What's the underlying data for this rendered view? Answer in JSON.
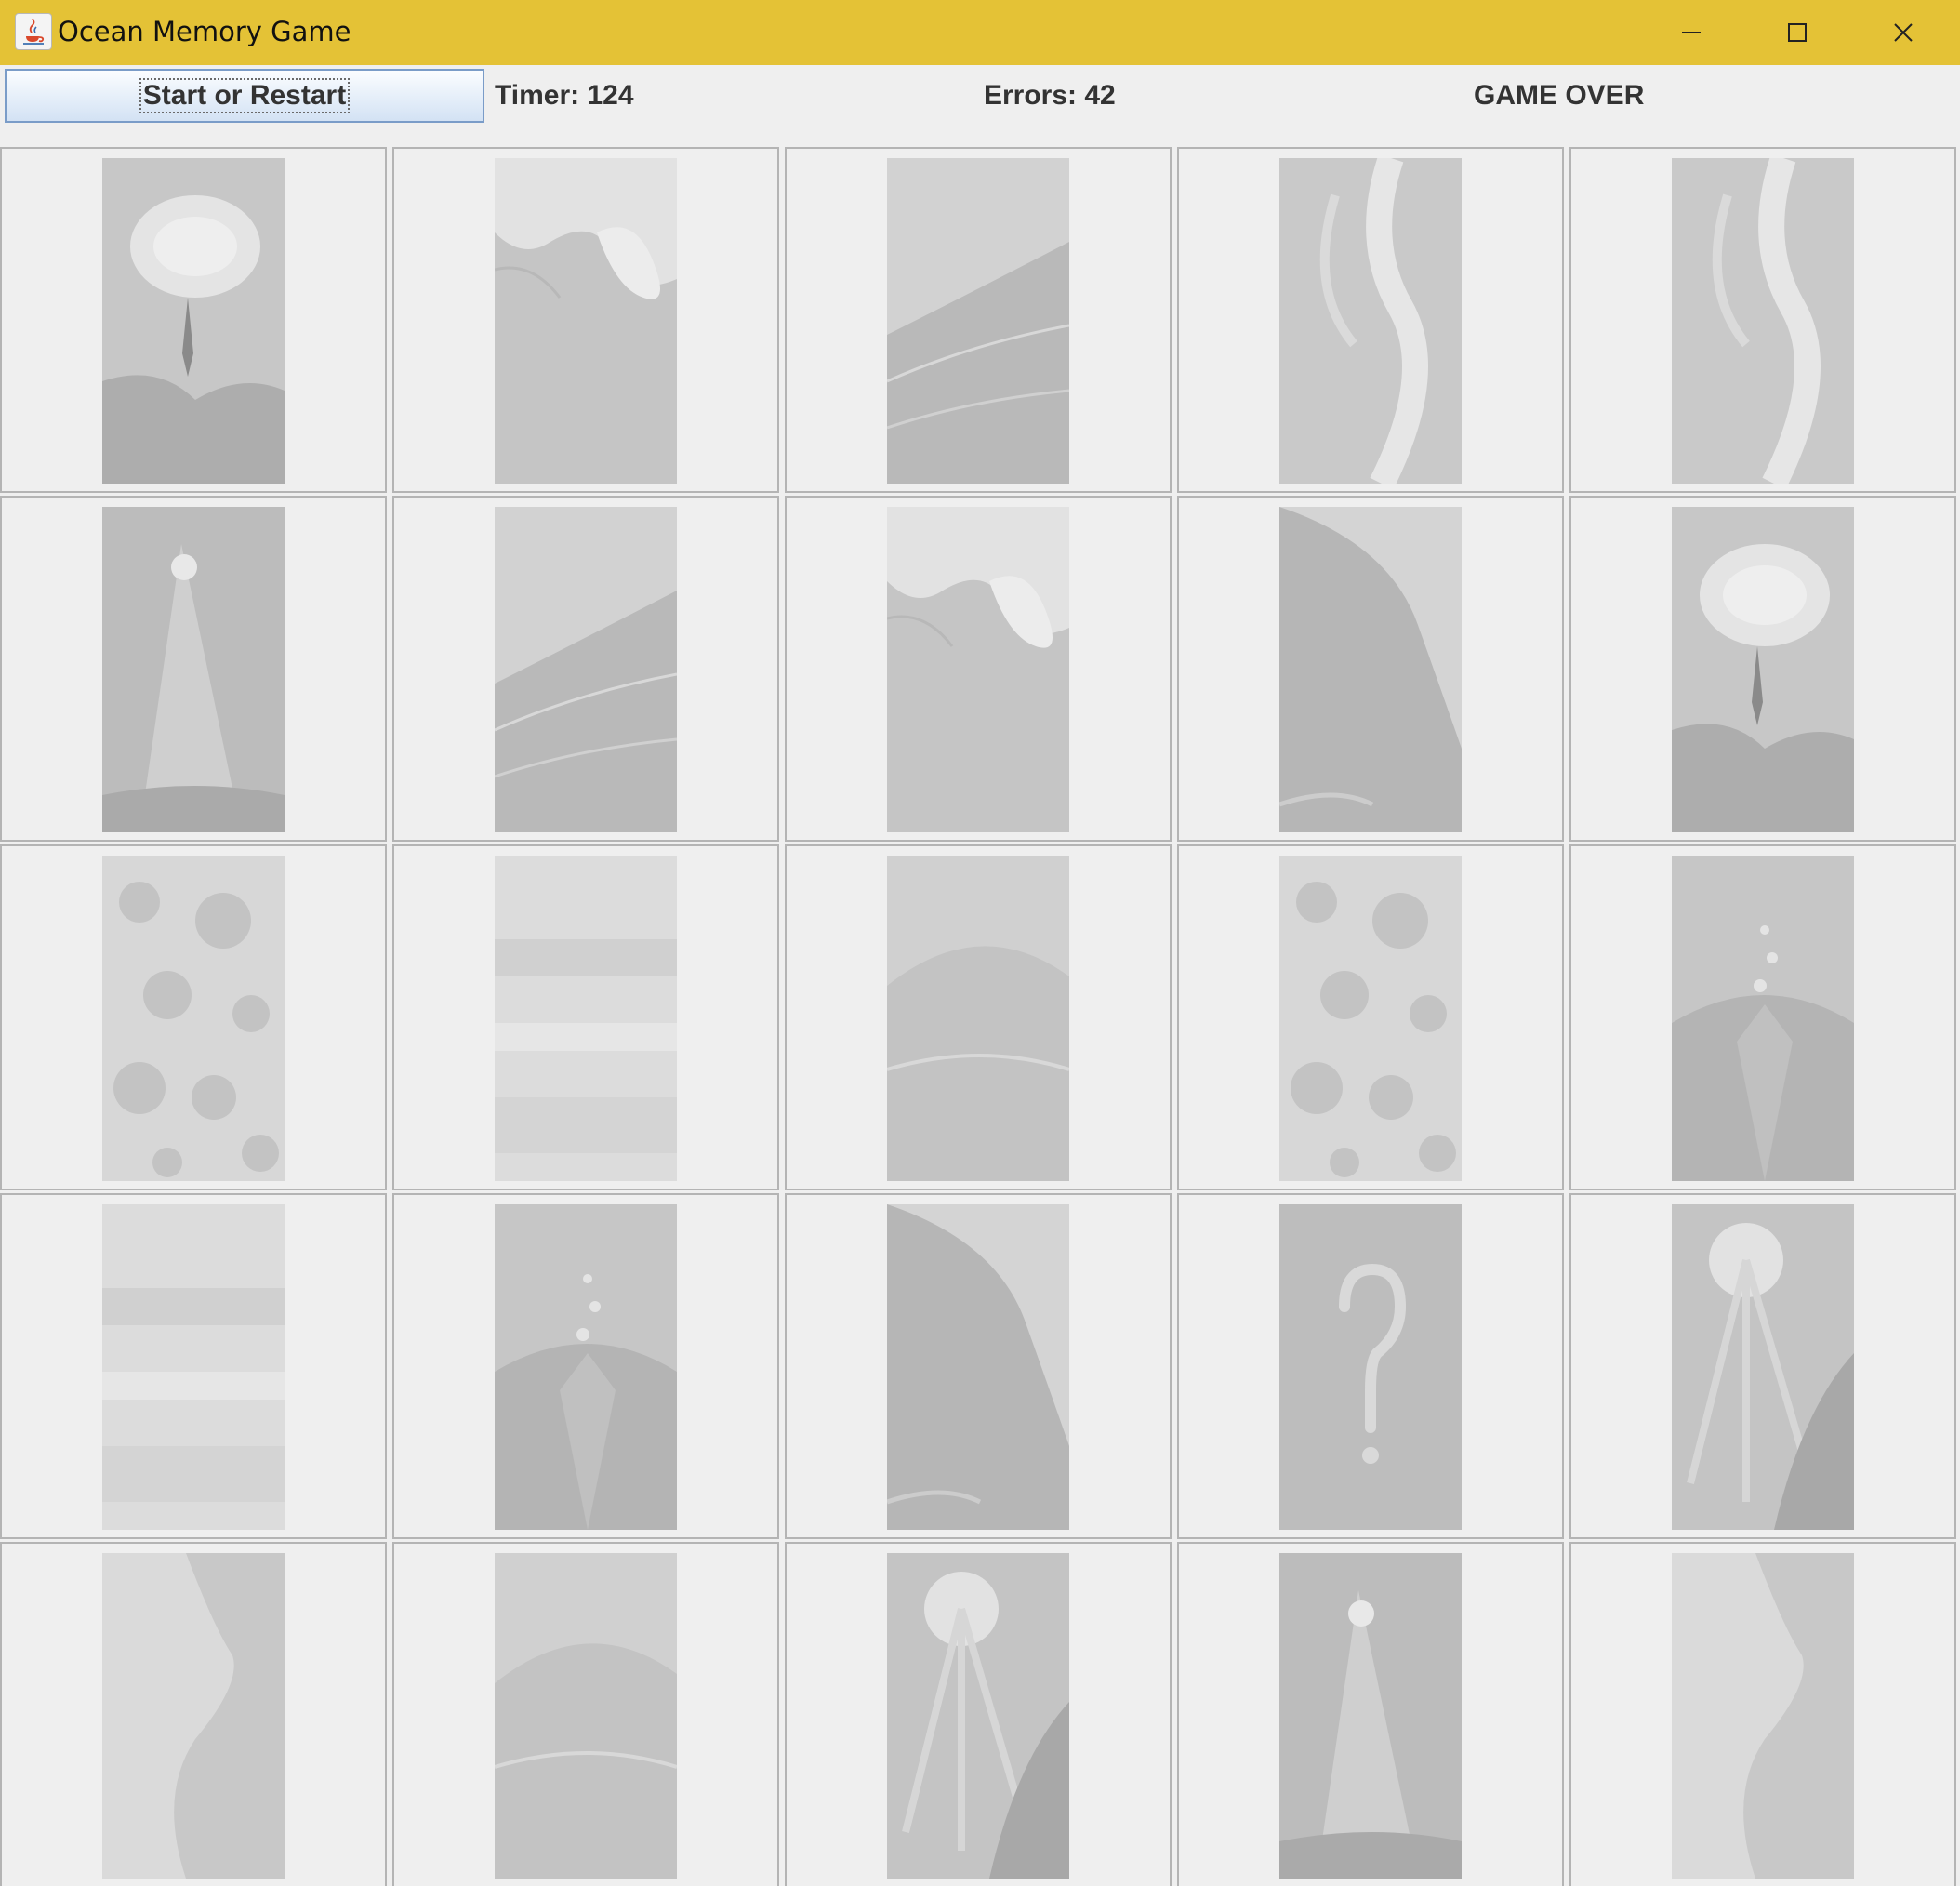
{
  "window": {
    "title": "Ocean Memory Game",
    "app_icon": "java-cup-icon",
    "title_bar_color": "#e4c236",
    "controls": [
      "minimize-icon",
      "maximize-icon",
      "close-icon"
    ]
  },
  "toolbar": {
    "start_button_label": "Start or Restart",
    "timer_text": "Timer: 124",
    "errors_text": "Errors: 42",
    "status_text": "GAME OVER"
  },
  "board": {
    "columns": 5,
    "cards": [
      {
        "image": "diver-cave"
      },
      {
        "image": "breaking-wave-spray"
      },
      {
        "image": "rolling-wave"
      },
      {
        "image": "aerial-foam"
      },
      {
        "image": "aerial-foam"
      },
      {
        "image": "underwater-cave-light"
      },
      {
        "image": "rolling-wave"
      },
      {
        "image": "breaking-wave-spray"
      },
      {
        "image": "curling-wave"
      },
      {
        "image": "diver-cave"
      },
      {
        "image": "foam-texture"
      },
      {
        "image": "misty-surf"
      },
      {
        "image": "wave-swell"
      },
      {
        "image": "foam-texture"
      },
      {
        "image": "splash-wave"
      },
      {
        "image": "misty-surf"
      },
      {
        "image": "splash-wave"
      },
      {
        "image": "curling-wave"
      },
      {
        "image": "question-mark"
      },
      {
        "image": "underwater-sunburst"
      },
      {
        "image": "aerial-shoreline"
      },
      {
        "image": "wave-swell"
      },
      {
        "image": "underwater-sunburst"
      },
      {
        "image": "underwater-cave-light"
      },
      {
        "image": "aerial-shoreline"
      }
    ]
  }
}
